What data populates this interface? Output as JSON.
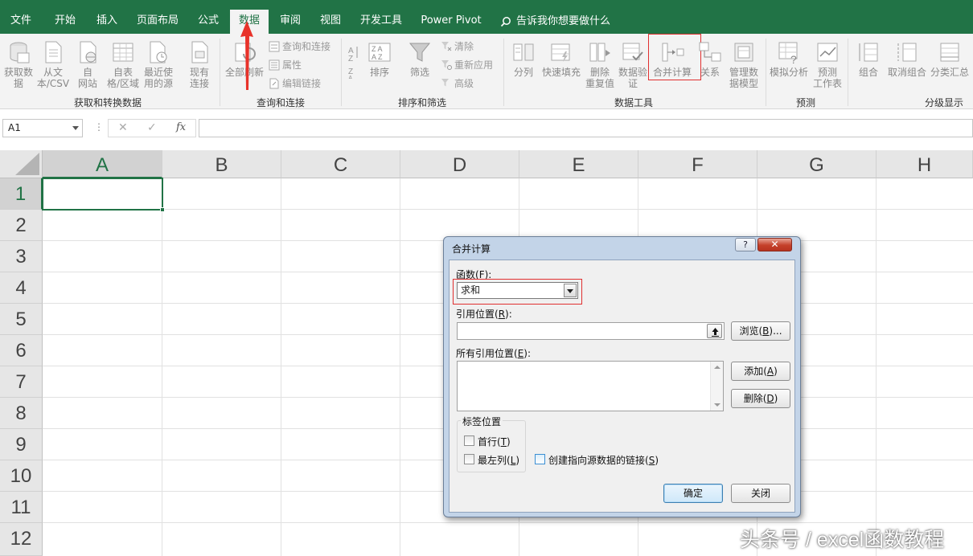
{
  "ribbon_tabs": {
    "file": "文件",
    "home": "开始",
    "insert": "插入",
    "page_layout": "页面布局",
    "formulas": "公式",
    "data": "数据",
    "review": "审阅",
    "view": "视图",
    "developer": "开发工具",
    "power_pivot": "Power Pivot",
    "tell_me": "告诉我你想要做什么",
    "active": "数据"
  },
  "ribbon": {
    "get_data_line1": "获取数",
    "get_data_line2": "据",
    "from_text_line1": "从文",
    "from_text_line2": "本/CSV",
    "from_web_line1": "自",
    "from_web_line2": "网站",
    "from_table_line1": "自表",
    "from_table_line2": "格/区域",
    "recent_sources_line1": "最近使",
    "recent_sources_line2": "用的源",
    "existing_conn_line1": "现有",
    "existing_conn_line2": "连接",
    "group_get_transform": "获取和转换数据",
    "refresh_all": "全部刷新",
    "queries_connections": "查询和连接",
    "properties": "属性",
    "edit_links": "编辑链接",
    "group_queries": "查询和连接",
    "sort": "排序",
    "filter": "筛选",
    "clear": "清除",
    "reapply": "重新应用",
    "advanced": "高级",
    "group_sort_filter": "排序和筛选",
    "text_to_columns": "分列",
    "flash_fill": "快速填充",
    "remove_dup_line1": "删除",
    "remove_dup_line2": "重复值",
    "validation_line1": "数据验",
    "validation_line2": "证",
    "consolidate": "合并计算",
    "relationships": "关系",
    "data_model_line1": "管理数",
    "data_model_line2": "据模型",
    "group_data_tools": "数据工具",
    "what_if": "模拟分析",
    "forecast_line1": "预测",
    "forecast_line2": "工作表",
    "group_forecast": "预测",
    "group_btn": "组合",
    "ungroup": "取消组合",
    "subtotal": "分类汇总",
    "group_outline": "分级显示"
  },
  "formula_bar": {
    "name_box": "A1",
    "dots": "⋮",
    "cancel_symbol": "✕",
    "enter_symbol": "✓",
    "fx_symbol": "fx",
    "formula": ""
  },
  "grid": {
    "columns": [
      "A",
      "B",
      "C",
      "D",
      "E",
      "F",
      "G",
      "H"
    ],
    "rows": [
      "1",
      "2",
      "3",
      "4",
      "5",
      "6",
      "7",
      "8",
      "9",
      "10",
      "11",
      "12"
    ],
    "active_cell": "A1"
  },
  "dialog": {
    "title": "合并计算",
    "help_symbol": "?",
    "close_symbol": "✕",
    "function_label": "函数(",
    "function_key": "F",
    "function_label_end": "):",
    "function_value": "求和",
    "reference_label": "引用位置(",
    "reference_key": "R",
    "reference_label_end": "):",
    "reference_value": "",
    "browse_label": "浏览(",
    "browse_key": "B",
    "browse_label_end": ")...",
    "all_refs_label": "所有引用位置(",
    "all_refs_key": "E",
    "all_refs_label_end": "):",
    "add_label": "添加(",
    "add_key": "A",
    "add_label_end": ")",
    "delete_label": "删除(",
    "delete_key": "D",
    "delete_label_end": ")",
    "labels_group": "标签位置",
    "top_row_label": "首行(",
    "top_row_key": "T",
    "top_row_label_end": ")",
    "top_row_checked": false,
    "left_col_label": "最左列(",
    "left_col_key": "L",
    "left_col_label_end": ")",
    "left_col_checked": false,
    "create_links_label": "创建指向源数据的链接(",
    "create_links_key": "S",
    "create_links_label_end": ")",
    "create_links_checked": false,
    "ok_label": "确定",
    "close_label": "关闭"
  },
  "watermark": "头条号 / excel函数教程",
  "colors": {
    "excel_green": "#217346",
    "highlight_red": "#e03030",
    "arrow_red": "#e8322a"
  }
}
